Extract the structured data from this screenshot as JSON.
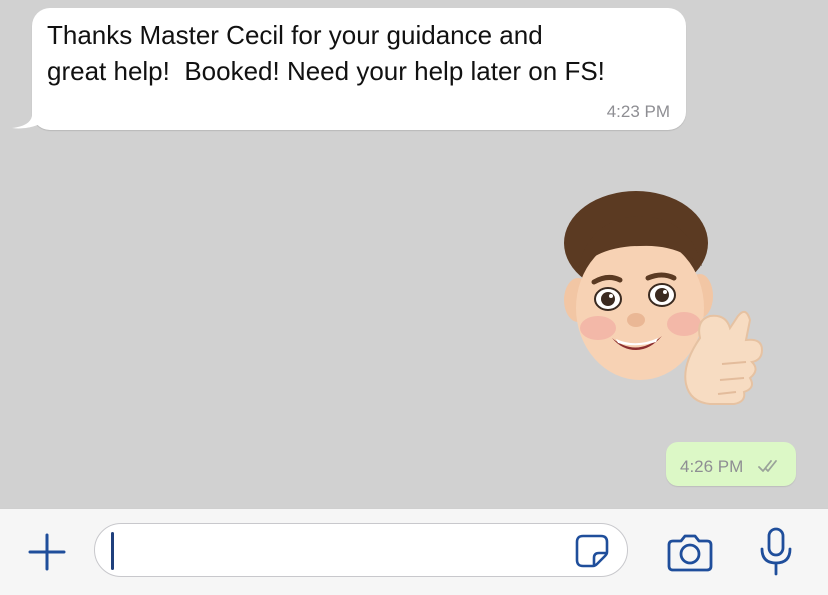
{
  "messages": [
    {
      "direction": "incoming",
      "text": "Thanks Master Cecil for your guidance and\ngreat help!  Booked! Need your help later on FS!",
      "time": "4:23 PM"
    },
    {
      "direction": "outgoing",
      "type": "sticker",
      "sticker": "memoji-thumbs-up",
      "time": "4:26 PM",
      "status": "read"
    }
  ],
  "composer": {
    "placeholder": "",
    "value": ""
  },
  "icons": {
    "attach": "plus-icon",
    "sticker": "sticker-icon",
    "camera": "camera-icon",
    "mic": "microphone-icon"
  },
  "colors": {
    "chat_background": "#d1d1d1",
    "incoming_bubble": "#ffffff",
    "outgoing_bubble": "#dcf8c6",
    "accent": "#1f4e9b",
    "timestamp": "#8e8e93"
  }
}
